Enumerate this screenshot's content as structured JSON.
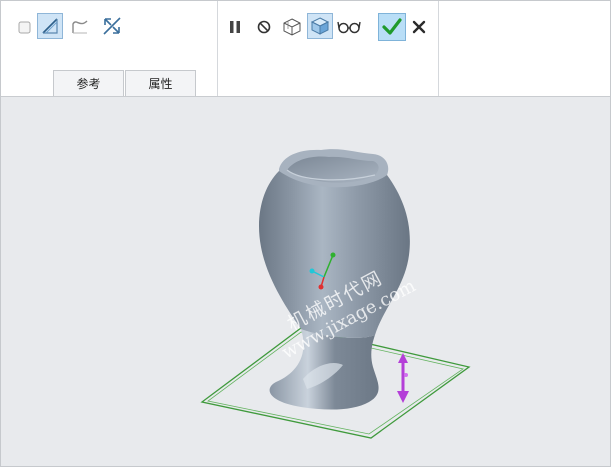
{
  "toolbar": {
    "left_group": [
      {
        "icon": "solid-box-icon",
        "active": false
      },
      {
        "icon": "surface-trim-icon",
        "active": true
      },
      {
        "icon": "surface-curve-icon",
        "active": false
      },
      {
        "icon": "flip-direction-icon",
        "active": false
      }
    ],
    "right_group": [
      {
        "icon": "pause-icon"
      },
      {
        "icon": "no-preview-icon"
      },
      {
        "icon": "geometry-preview-icon"
      },
      {
        "icon": "feature-preview-icon",
        "active": true
      },
      {
        "icon": "verify-mode-icon"
      }
    ],
    "confirm_icon": "checkmark-icon",
    "cancel_icon": "close-icon"
  },
  "tabs": [
    {
      "label": "参考"
    },
    {
      "label": "属性"
    }
  ],
  "viewport": {
    "background": "#e8eaed",
    "model": "vase-surface-model",
    "datum_plane_color": "#3f9a3c",
    "drag_handle_color": "#b43fd8",
    "watermark": {
      "line1": "机械时代网",
      "line2": "www.jixage.com"
    }
  }
}
